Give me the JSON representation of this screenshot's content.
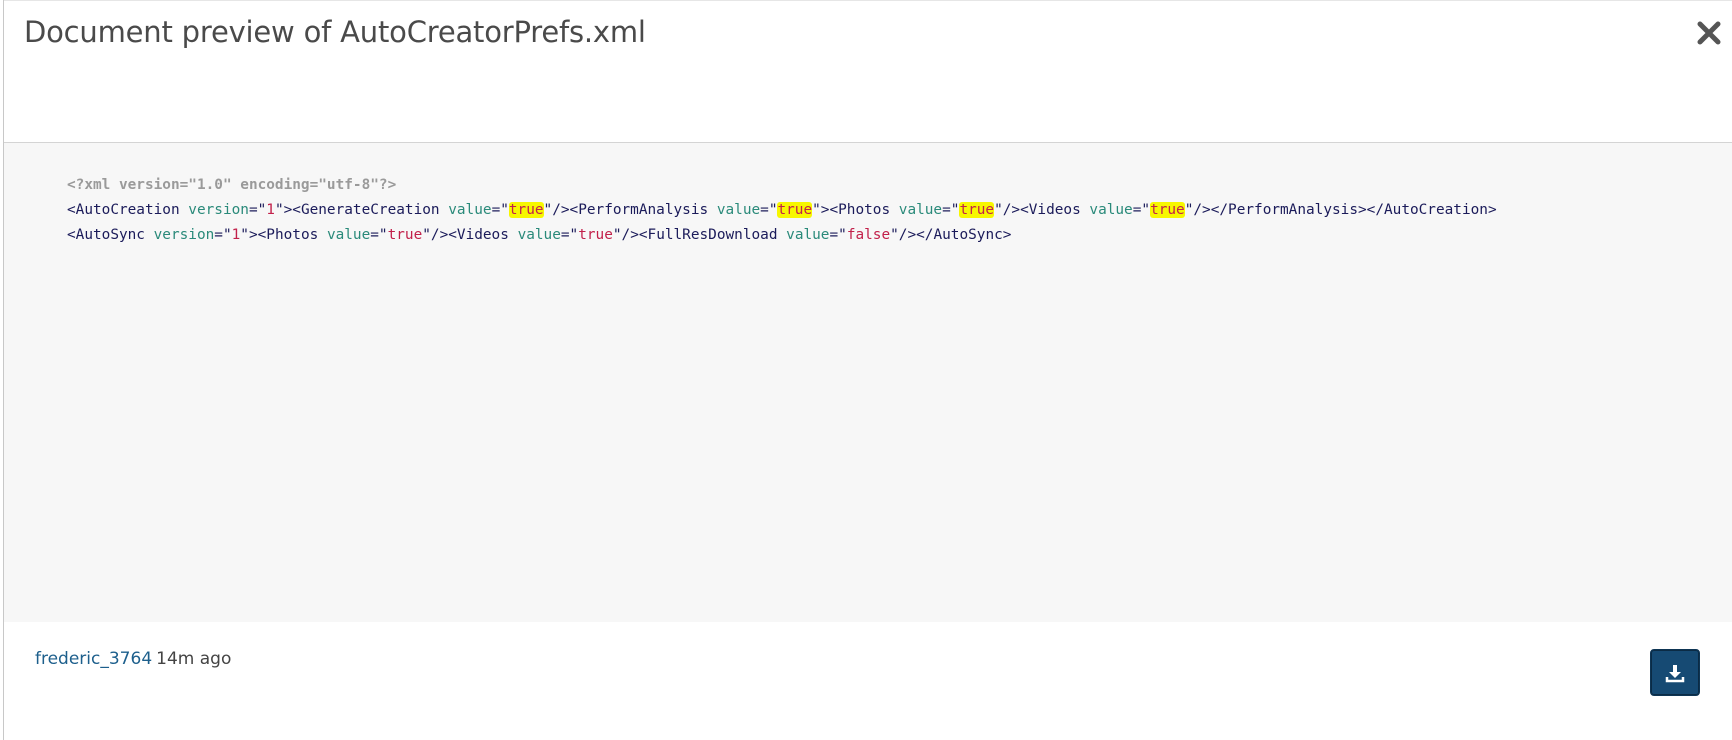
{
  "header": {
    "title": "Document preview of AutoCreatorPrefs.xml"
  },
  "icons": {
    "close": "close-icon",
    "download": "download-icon"
  },
  "code": {
    "line1": {
      "decl": "<?xml version=\"1.0\" encoding=\"utf-8\"?>"
    },
    "line2": {
      "t1": "<AutoCreation ",
      "a1": "version",
      "e1": "=\"",
      "v1": "1",
      "t2": "\"><GenerateCreation ",
      "a2": "value",
      "e2": "=\"",
      "v2": "true",
      "t3": "\"/><PerformAnalysis ",
      "a3": "value",
      "e3": "=\"",
      "v3": "true",
      "t4": "\"><Photos ",
      "a4": "value",
      "e4": "=\"",
      "v4": "true",
      "t5": "\"/><Videos ",
      "a5": "value",
      "e5": "=\"",
      "v5": "true",
      "t6": "\"/></PerformAnalysis></AutoCreation>"
    },
    "line3": {
      "t1": "<AutoSync ",
      "a1": "version",
      "e1": "=\"",
      "v1": "1",
      "t2": "\"><Photos ",
      "a2": "value",
      "e2": "=\"",
      "v2": "true",
      "t3": "\"/><Videos ",
      "a3": "value",
      "e3": "=\"",
      "v3": "true",
      "t4": "\"/><FullResDownload ",
      "a4": "value",
      "e4": "=\"",
      "v4": "false",
      "t5": "\"/></AutoSync>"
    }
  },
  "footer": {
    "username": "frederic_3764",
    "timestamp": "14m ago"
  },
  "colors": {
    "highlight": "#f7f700",
    "download_button": "#164a73",
    "link": "#1d5f8c",
    "code_background": "#f7f7f7"
  }
}
